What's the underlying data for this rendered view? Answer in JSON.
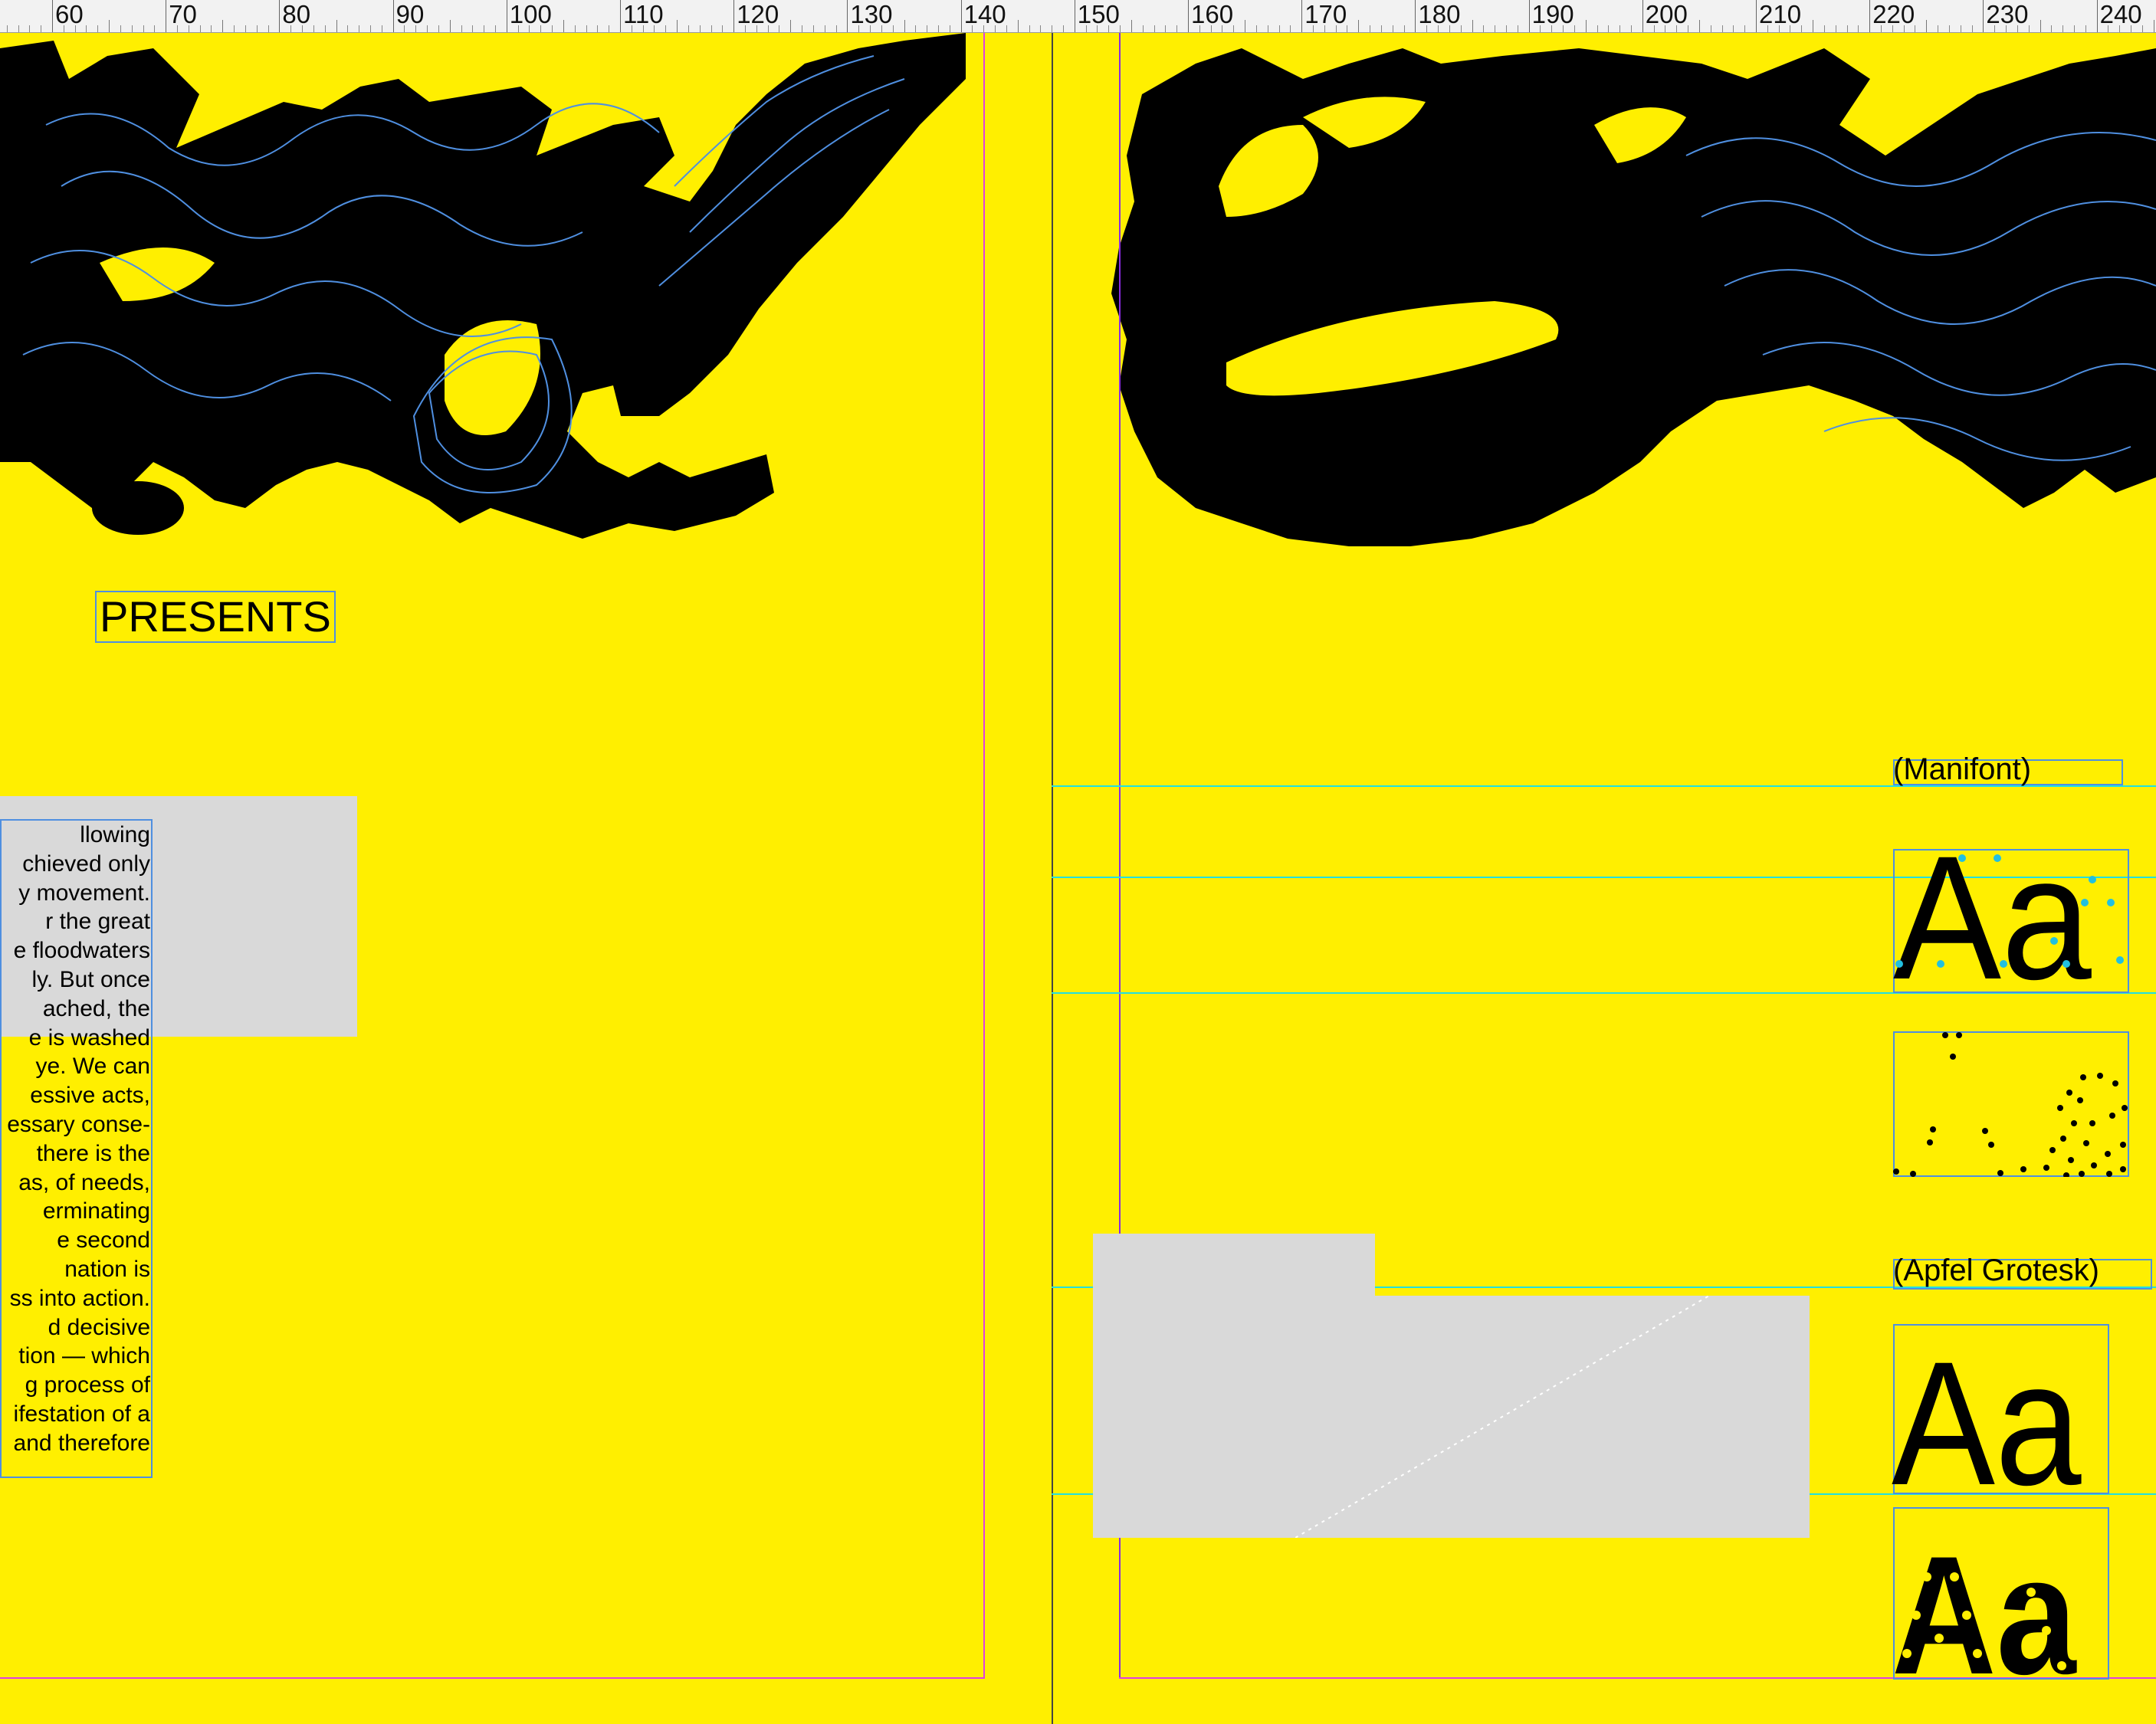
{
  "ruler": {
    "labels": [
      "60",
      "70",
      "80",
      "90",
      "100",
      "110",
      "120",
      "130",
      "140",
      "150",
      "160",
      "170",
      "180",
      "190",
      "200",
      "210",
      "220",
      "230",
      "240"
    ]
  },
  "left_page": {
    "presents": "PRESENTS",
    "body_lines": [
      "llowing",
      "chieved only",
      "y movement.",
      "r the great",
      "e floodwaters",
      "ly. But once",
      "ached, the",
      "e is washed",
      "ye. We can",
      "essive acts,",
      "essary conse-",
      "there is the",
      "as, of needs,",
      "erminating",
      "e second",
      "nation is",
      "ss into action.",
      "d decisive",
      "tion — which",
      "g process of",
      "ifestation of a",
      "and therefore"
    ]
  },
  "right_page": {
    "font1_label": "(Manifont)",
    "font1_specimen": "Aa",
    "font2_label": "(Apfel Grotesk)",
    "font2_specimen": "Aa",
    "font2_specimen_dotted": "Aa"
  },
  "colors": {
    "page": "#ffef00",
    "guide_cyan": "#22e0e0",
    "guide_magenta": "#e040e0",
    "guide_purple": "#8a2be2",
    "frame_blue": "#4f8fe0",
    "placeholder_gray": "#d9d9d9"
  }
}
